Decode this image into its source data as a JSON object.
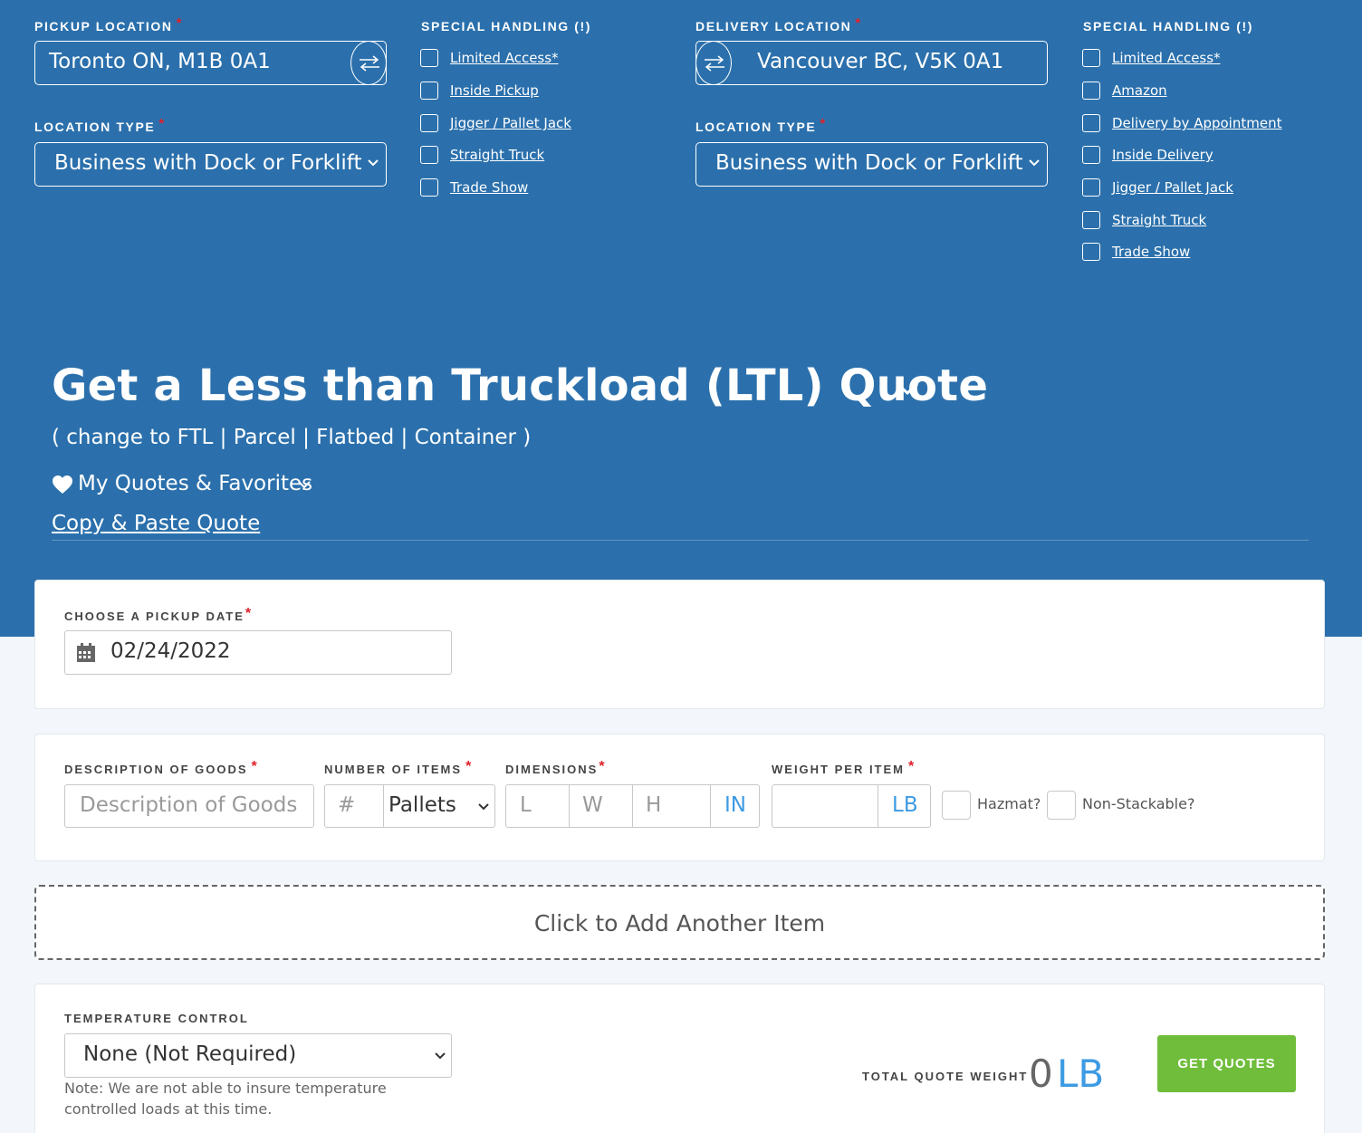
{
  "pickup": {
    "label": "PICKUP LOCATION",
    "value": "Toronto ON, M1B 0A1",
    "location_type_label": "LOCATION TYPE",
    "location_type_value": "Business with Dock or Forklift",
    "special_label": "SPECIAL HANDLING (!)",
    "special_items": [
      "Limited Access*",
      "Inside Pickup",
      "Jigger / Pallet Jack",
      "Straight Truck",
      "Trade Show"
    ]
  },
  "delivery": {
    "label": "DELIVERY LOCATION",
    "value": "Vancouver BC, V5K 0A1",
    "location_type_label": "LOCATION TYPE",
    "location_type_value": "Business with Dock or Forklift",
    "special_label": "SPECIAL HANDLING (!)",
    "special_items": [
      "Limited Access*",
      "Amazon",
      "Delivery by Appointment",
      "Inside Delivery",
      "Jigger / Pallet Jack",
      "Straight Truck",
      "Trade Show"
    ]
  },
  "required_mark": "*",
  "hero": {
    "title": "Get a Less than Truckload (LTL) Quote",
    "change_to": "( change to FTL | Parcel | Flatbed | Container )",
    "favorites": "My Quotes & Favorites",
    "copy_paste": "Copy & Paste Quote"
  },
  "date_card": {
    "label": "CHOOSE A PICKUP DATE",
    "value": "02/24/2022"
  },
  "item_card": {
    "desc_label": "DESCRIPTION OF GOODS",
    "desc_placeholder": "Description of Goods",
    "num_label": "NUMBER OF ITEMS",
    "num_placeholder": "#",
    "unit_value": "Pallets",
    "dim_label": "DIMENSIONS",
    "dim_l": "L",
    "dim_w": "W",
    "dim_h": "H",
    "dim_unit": "IN",
    "weight_label": "WEIGHT PER ITEM",
    "weight_unit": "LB",
    "hazmat": "Hazmat?",
    "nonstack": "Non-Stackable?"
  },
  "add_item": "Click to Add Another Item",
  "temp_card": {
    "label": "TEMPERATURE CONTROL",
    "value": "None (Not Required)",
    "note": "Note: We are not able to insure temperature controlled loads at this time.",
    "total_label": "TOTAL QUOTE WEIGHT",
    "total_value": "0",
    "total_unit": "LB",
    "get_quotes": "GET QUOTES"
  },
  "colors": {
    "hero_bg": "#2b70ac",
    "required": "#e0202a",
    "accent_blue": "#3d9be3",
    "button_green": "#6fbd3b"
  }
}
